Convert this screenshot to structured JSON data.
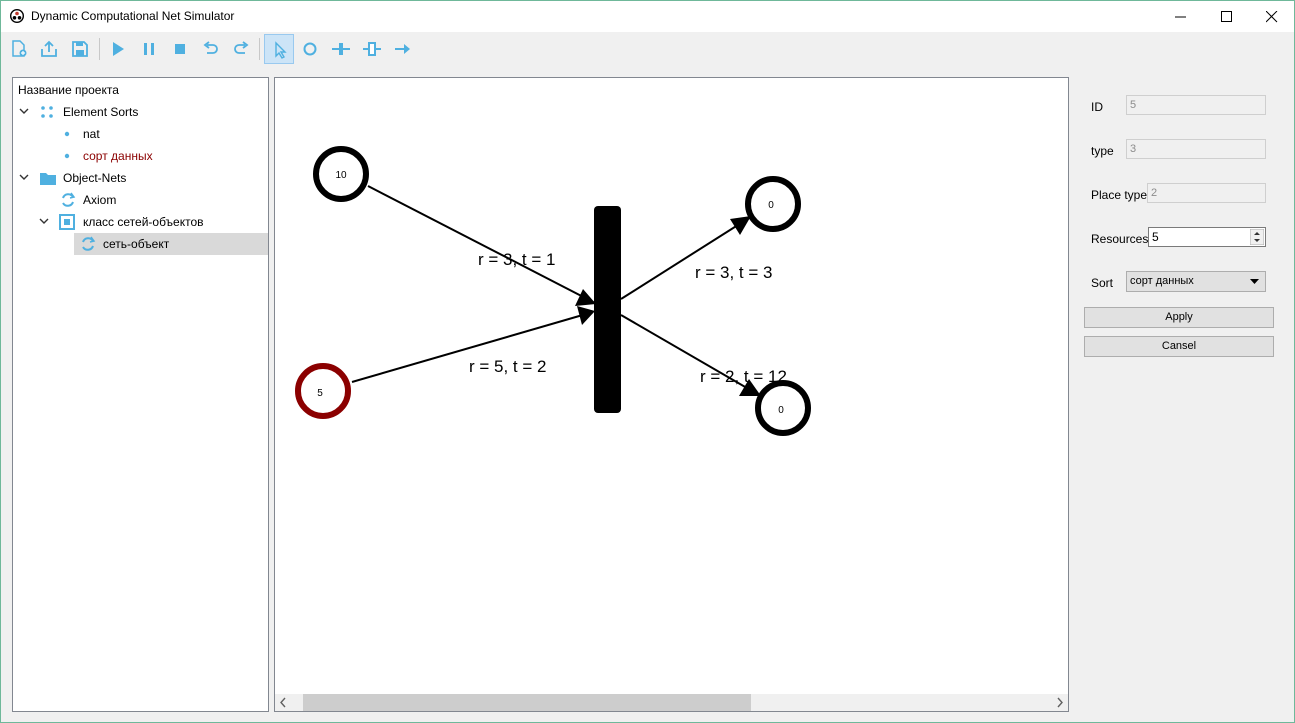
{
  "window": {
    "title": "Dynamic Computational Net Simulator"
  },
  "toolbar": {
    "buttons": [
      "new-file-icon",
      "import-icon",
      "save-icon",
      "play-icon",
      "pause-icon",
      "stop-icon",
      "undo-icon",
      "redo-icon",
      "pointer-icon",
      "place-icon",
      "transition-icon",
      "transition-alt-icon",
      "arc-icon"
    ],
    "active": "pointer-icon"
  },
  "tree": {
    "root": "Название проекта",
    "element_sorts": "Element Sorts",
    "sort_nat": "nat",
    "sort_data": "сорт данных",
    "object_nets": "Object-Nets",
    "axiom": "Axiom",
    "net_class": "класс сетей-объектов",
    "object_net": "сеть-объект"
  },
  "net": {
    "places": [
      {
        "label": "10",
        "color": "#000000"
      },
      {
        "label": "5",
        "color": "#8b0000"
      },
      {
        "label": "0",
        "color": "#000000"
      },
      {
        "label": "0",
        "color": "#000000"
      }
    ],
    "arcs": [
      {
        "label": "r = 3, t = 1"
      },
      {
        "label": "r = 5, t = 2"
      },
      {
        "label": "r = 3, t = 3"
      },
      {
        "label": "r = 2, t = 12"
      }
    ]
  },
  "props": {
    "id_label": "ID",
    "id_value": "5",
    "type_label": "type",
    "type_value": "3",
    "place_type_label": "Place type",
    "place_type_value": "2",
    "resources_label": "Resources",
    "resources_value": "5",
    "sort_label": "Sort",
    "sort_value": "сорт данных",
    "apply_label": "Apply",
    "cancel_label": "Cansel"
  },
  "colors": {
    "accent": "#4fb0e0",
    "highlight_text": "#8b0000"
  }
}
